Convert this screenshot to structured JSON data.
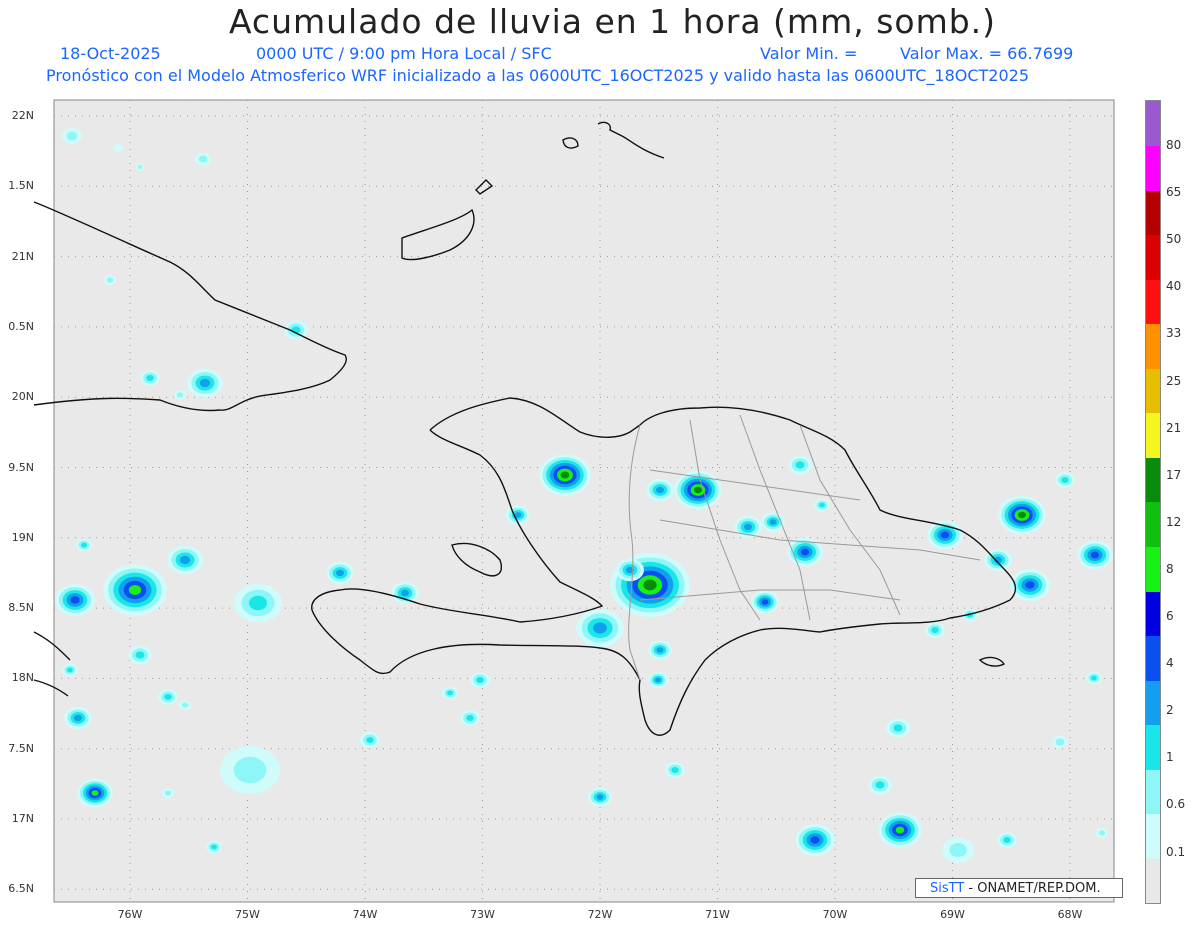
{
  "header": {
    "title": "Acumulado de lluvia en 1 hora (mm, somb.)",
    "date": "18-Oct-2025",
    "time": "0000 UTC / 9:00 pm Hora Local / SFC",
    "min_label": "Valor Min. =",
    "max_label": "Valor Max. = 66.7699",
    "model_line": "Pronóstico con el Modelo Atmosferico WRF inicializado a las 0600UTC_16OCT2025 y valido hasta las  0600UTC_18OCT2025"
  },
  "axes": {
    "lat_labels": [
      "22N",
      "1.5N",
      "21N",
      "0.5N",
      "20N",
      "9.5N",
      "19N",
      "8.5N",
      "18N",
      "7.5N",
      "17N",
      "6.5N"
    ],
    "lon_labels": [
      "76W",
      "75W",
      "74W",
      "73W",
      "72W",
      "71W",
      "70W",
      "69W",
      "68W"
    ]
  },
  "colorbar": {
    "labels": [
      "80",
      "65",
      "50",
      "40",
      "33",
      "25",
      "21",
      "17",
      "12",
      "8",
      "6",
      "4",
      "2",
      "1",
      "0.6",
      "0.1"
    ],
    "colors": [
      "#e8e8e8",
      "#cffbfb",
      "#8ef6f6",
      "#19e6e6",
      "#139ef0",
      "#0a50f0",
      "#0000e0",
      "#18f018",
      "#10c010",
      "#0a8a0a",
      "#f5f520",
      "#e6be00",
      "#ff9000",
      "#ff1010",
      "#dd0000",
      "#b40000",
      "#ff00ff",
      "#9b59d0"
    ]
  },
  "credit": {
    "brand": "SisTT",
    "text": " - ONAMET/REP.DOM."
  },
  "colors": {
    "map_background": "#e9e9e9",
    "title_text": "#222222",
    "subtitle_text": "#1a66ff"
  }
}
